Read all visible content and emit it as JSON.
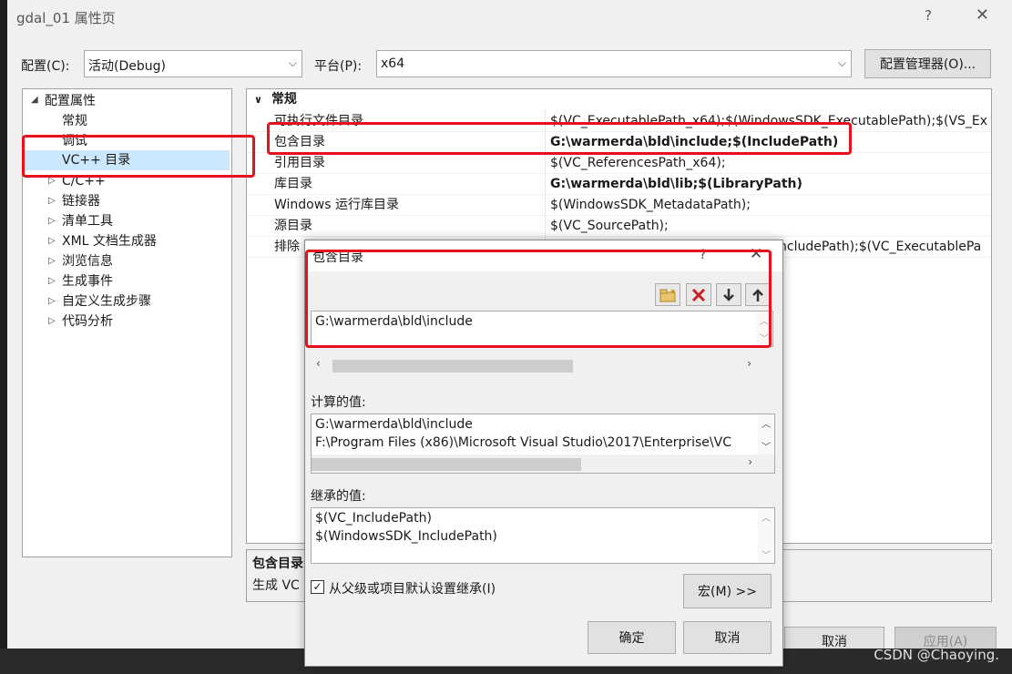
{
  "window": {
    "title": "gdal_01 属性页",
    "help": "?",
    "close": "✕"
  },
  "toolbar": {
    "config_label": "配置(C):",
    "config_value": "活动(Debug)",
    "platform_label": "平台(P):",
    "platform_value": "x64",
    "config_manager": "配置管理器(O)..."
  },
  "tree": {
    "root": "配置属性",
    "items": [
      "常规",
      "调试",
      "VC++ 目录",
      "C/C++",
      "链接器",
      "清单工具",
      "XML 文档生成器",
      "浏览信息",
      "生成事件",
      "自定义生成步骤",
      "代码分析"
    ]
  },
  "grid": {
    "section": "常规",
    "rows": [
      {
        "name": "可执行文件目录",
        "value": "$(VC_ExecutablePath_x64);$(WindowsSDK_ExecutablePath);$(VS_Ex"
      },
      {
        "name": "包含目录",
        "value": "G:\\warmerda\\bld\\include;$(IncludePath)"
      },
      {
        "name": "引用目录",
        "value": "$(VC_ReferencesPath_x64);"
      },
      {
        "name": "库目录",
        "value": "G:\\warmerda\\bld\\lib;$(LibraryPath)"
      },
      {
        "name": "Windows 运行库目录",
        "value": "$(WindowsSDK_MetadataPath);"
      },
      {
        "name": "源目录",
        "value": "$(VC_SourcePath);"
      },
      {
        "name": "排除",
        "value": "ncludePath);$(VC_ExecutablePa"
      }
    ]
  },
  "description": {
    "title": "包含目录",
    "text": "生成 VC"
  },
  "main_buttons": {
    "cancel": "取消",
    "apply": "应用(A)"
  },
  "dialog": {
    "title": "包含目录",
    "help": "?",
    "close": "✕",
    "entries": [
      "G:\\warmerda\\bld\\include"
    ],
    "computed_label": "计算的值:",
    "computed_values": [
      "G:\\warmerda\\bld\\include",
      "F:\\Program Files (x86)\\Microsoft Visual Studio\\2017\\Enterprise\\VC"
    ],
    "inherited_label": "继承的值:",
    "inherited_values": [
      "$(VC_IncludePath)",
      "$(WindowsSDK_IncludePath)"
    ],
    "inherit_checkbox": "从父级或项目默认设置继承(I)",
    "macro_button": "宏(M) >>",
    "ok": "确定",
    "cancel": "取消"
  },
  "watermark": "CSDN @Chaoying.",
  "colors": {
    "highlight_red": "#e8101a",
    "selection": "#cce8ff",
    "window_bg": "#f0f0f0"
  }
}
